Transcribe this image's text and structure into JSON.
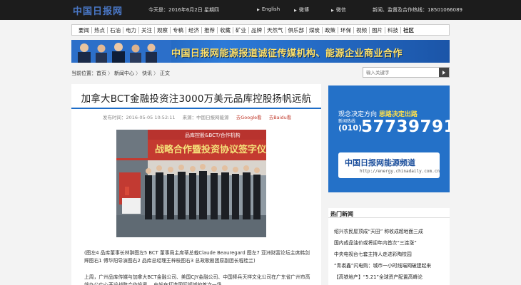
{
  "topbar": {
    "logo": "中国日报网",
    "today": "今天是：2016年6月2日 星期四",
    "langs": [
      {
        "label": "English"
      },
      {
        "label": "微博"
      },
      {
        "label": "微信"
      }
    ],
    "hotline": "新闻、监督及合作热线：18501066089"
  },
  "nav": {
    "items": [
      "要闻",
      "热点",
      "石油",
      "电力",
      "关注",
      "观察",
      "专稿",
      "经济",
      "推荐",
      "收藏",
      "矿业",
      "品牌",
      "天然气",
      "俱乐部",
      "煤炭",
      "政策",
      "环保",
      "视频",
      "图片",
      "科技",
      "社区"
    ]
  },
  "banner": {
    "text": "中国日报网能源报道诚征传媒机构、能源企业商业合作"
  },
  "breadcrumb": {
    "prefix": "当前位置：",
    "items": [
      "首页",
      "新闻中心",
      "快讯",
      "正文"
    ],
    "sep": "〉"
  },
  "search": {
    "placeholder": "输入关键字"
  },
  "article": {
    "title": "加拿大BCT金融投资注3000万美元品库控股扬帆远航",
    "time": "发布时间：2016-05-05 10:52:11",
    "source": "来源：中国日报网能源",
    "share1": "去Google看",
    "share2": "去Baidu看",
    "photo_banner": "战略合作暨投资协议签字仪式",
    "photo_header": "品库控股&BCT/合作机构",
    "caption": "(图左4 品库董事长林翀图左5 BCT 董事局主席蒂总裁Claude Beauregard 图左7 亚洲财富论坛主席韩剑辉图右1 傅华阳导演图右2 品库总经理王梓枝图右3 总政歌剧团原副团长程桂兰)",
    "para": "上周，广州品库传媒与加拿大BCT金融公司、美国CJY金融公司、中国棒兵天祥文化公司在广东省广州市高端办公中心开设战略合作投资… 由旨在打造国际领域的首次一场…"
  },
  "ad": {
    "line1a": "观念决定方向",
    "line1b": "思路决定出路",
    "hot_label": "新闻热线",
    "tel": "(010)",
    "number": "57739791",
    "box_title": "中国日报网能源频道",
    "box_url": "http://energy.chinadaily.com.cn"
  },
  "hot": {
    "title": "热门新闻",
    "items": [
      "绍兴农民屋顶成“天田” 称收成超地面三成",
      "国内成品油价或将迎年内首次“三连涨”",
      "中央电视台七套主持人走进彩陶校园",
      "“青裘鑫”闪电购：城市一小时线端网破建起来",
      "【高铁地产】“5.21”全球资产配置高峰论"
    ]
  },
  "colors": {
    "topbar": "#1c1c1c",
    "accent": "#1d6cc7",
    "ad_blue": "#2471c8",
    "banner_text": "#ffe26a"
  }
}
